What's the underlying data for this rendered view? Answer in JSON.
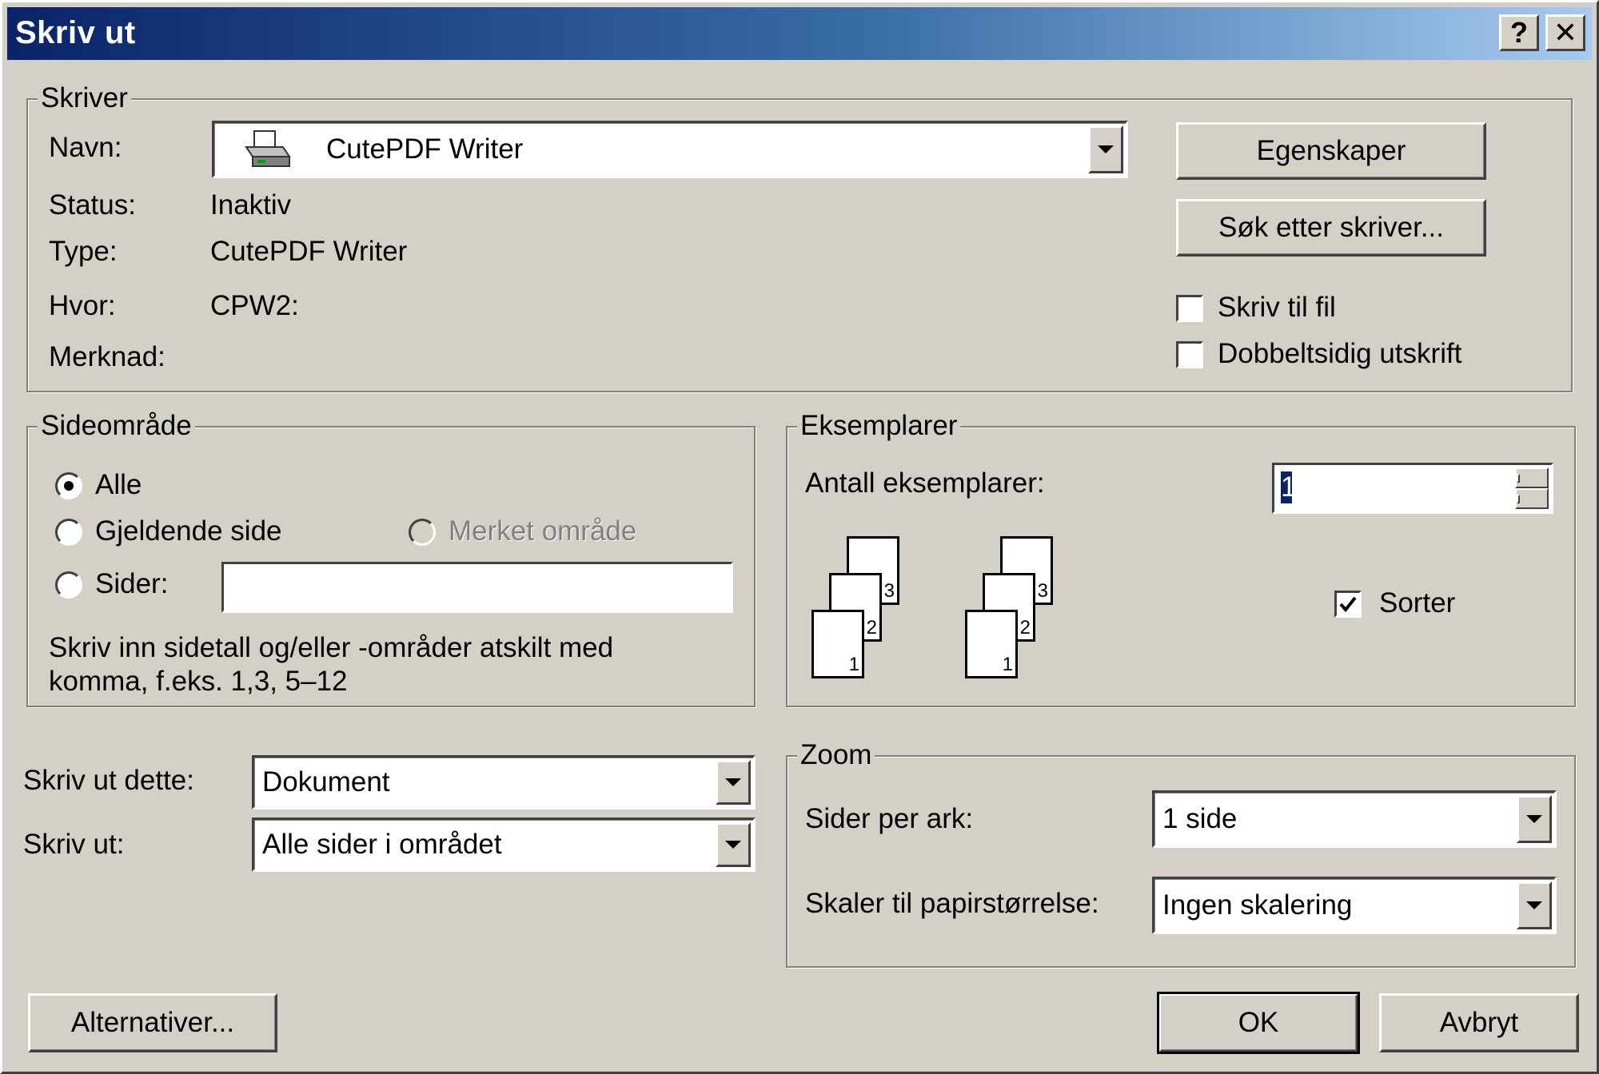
{
  "window": {
    "title": "Skriv ut"
  },
  "titlebar_buttons": {
    "help": "?",
    "close": "✕"
  },
  "printer": {
    "group_label": "Skriver",
    "name_label": "Navn:",
    "name_value": "CutePDF Writer",
    "status_label": "Status:",
    "status_value": "Inaktiv",
    "type_label": "Type:",
    "type_value": "CutePDF Writer",
    "where_label": "Hvor:",
    "where_value": "CPW2:",
    "comment_label": "Merknad:",
    "properties_button": "Egenskaper",
    "find_printer_button": "Søk etter skriver...",
    "print_to_file_label": "Skriv til fil",
    "print_to_file_checked": false,
    "duplex_label": "Dobbeltsidig utskrift",
    "duplex_checked": false
  },
  "page_range": {
    "group_label": "Sideområde",
    "all_label": "Alle",
    "current_page_label": "Gjeldende side",
    "selection_label": "Merket område",
    "pages_label": "Sider:",
    "pages_value": "",
    "selected": "all",
    "hint_line1": "Skriv inn sidetall og/eller -områder atskilt med",
    "hint_line2": "komma, f.eks. 1,3, 5–12"
  },
  "copies": {
    "group_label": "Eksemplarer",
    "count_label": "Antall eksemplarer:",
    "count_value": "1",
    "collate_label": "Sorter",
    "collate_checked": true,
    "page_numbers": [
      "1",
      "2",
      "3"
    ]
  },
  "print_what": {
    "label": "Skriv ut dette:",
    "value": "Dokument"
  },
  "print": {
    "label": "Skriv ut:",
    "value": "Alle sider i området"
  },
  "zoom": {
    "group_label": "Zoom",
    "pages_per_sheet_label": "Sider per ark:",
    "pages_per_sheet_value": "1 side",
    "scale_label": "Skaler til papirstørrelse:",
    "scale_value": "Ingen skalering"
  },
  "footer": {
    "options_button": "Alternativer...",
    "ok_button": "OK",
    "cancel_button": "Avbryt"
  },
  "icons": {
    "printer": "printer-icon"
  }
}
